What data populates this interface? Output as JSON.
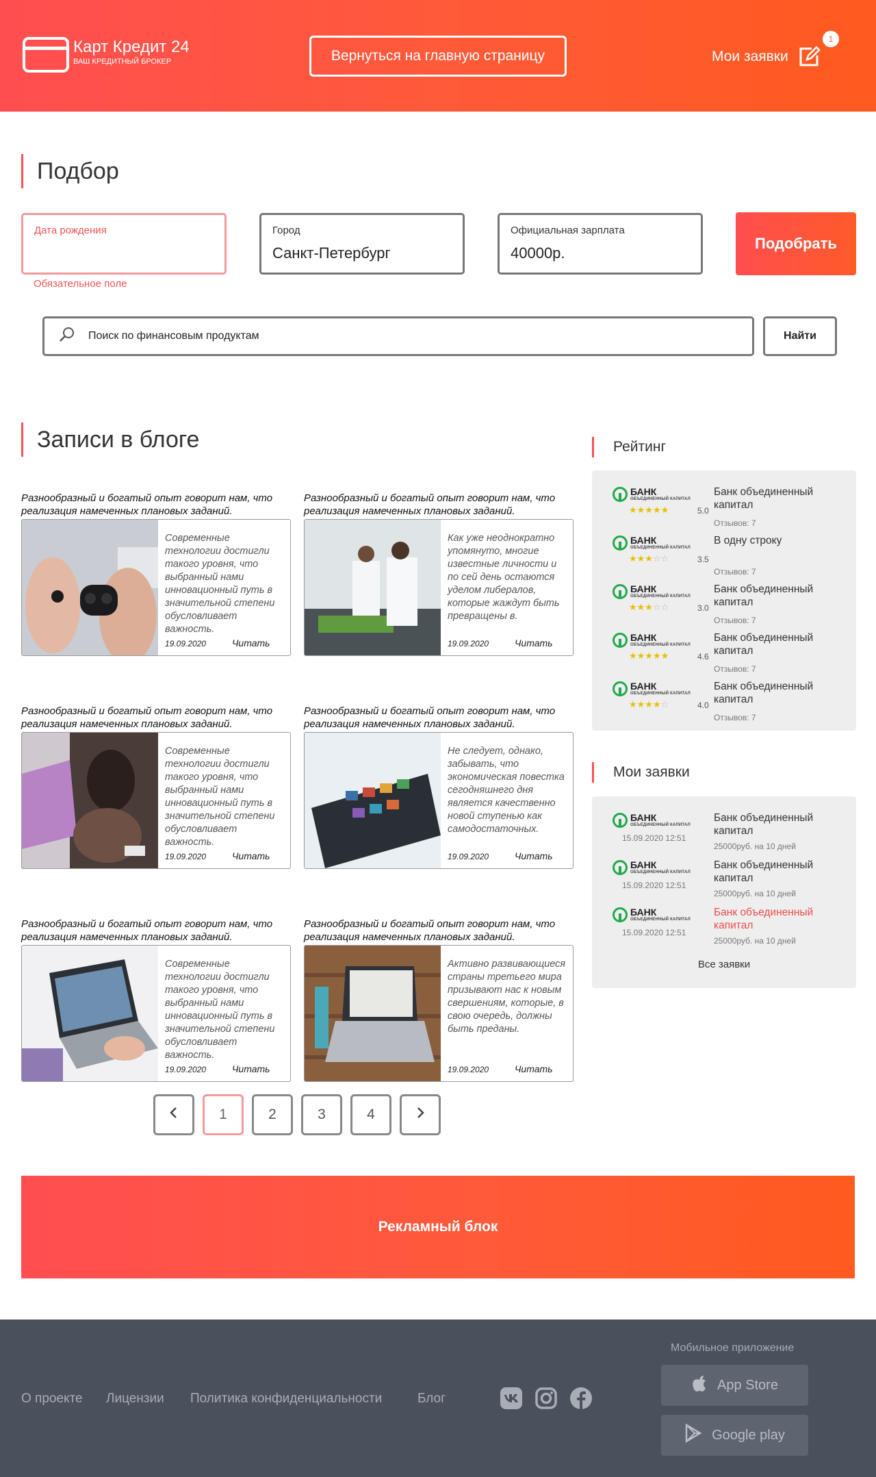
{
  "header": {
    "logo_title": "Карт Кредит 24",
    "logo_subtitle": "ВАШ КРЕДИТНЫЙ БРОКЕР",
    "back_button": "Вернуться на главную страницу",
    "my_apps": "Мои заявки",
    "badge_count": "1"
  },
  "filter": {
    "title": "Подбор",
    "birth_label": "Дата рождения",
    "birth_value": "",
    "required_msg": "Обязательное поле",
    "city_label": "Город",
    "city_value": "Санкт-Петербург",
    "salary_label": "Официальная зарплата",
    "salary_value": "40000р.",
    "submit": "Подобрать",
    "search_placeholder": "Поиск по финансовым продуктам",
    "search_button": "Найти"
  },
  "blog": {
    "title": "Записи в блоге",
    "posts": [
      {
        "title": "Разнообразный и богатый опыт говорит нам, что реализация намеченных плановых заданий.",
        "text": "Современные технологии достигли такого уровня, что выбранный нами инновационный путь в значительной степени обусловливает важность.",
        "date": "19.09.2020",
        "read": "Читать"
      },
      {
        "title": "Разнообразный и богатый опыт говорит нам, что реализация намеченных плановых заданий.",
        "text": "Как уже неоднократно упомянуто, многие известные личности и по сей день остаются уделом либералов, которые жаждут быть превращены в.",
        "date": "19.09.2020",
        "read": "Читать"
      },
      {
        "title": "Разнообразный и богатый опыт говорит нам, что реализация намеченных плановых заданий.",
        "text": "Современные технологии достигли такого уровня, что выбранный нами инновационный путь в значительной степени обусловливает важность.",
        "date": "19.09.2020",
        "read": "Читать"
      },
      {
        "title": "Разнообразный и богатый опыт говорит нам, что реализация намеченных плановых заданий.",
        "text": "Не следует, однако, забывать, что экономическая повестка сегодняшнего дня является качественно новой ступенью как самодостаточных.",
        "date": "19.09.2020",
        "read": "Читать"
      },
      {
        "title": "Разнообразный и богатый опыт говорит нам, что реализация намеченных плановых заданий.",
        "text": "Современные технологии достигли такого уровня, что выбранный нами инновационный путь в значительной степени обусловливает важность.",
        "date": "19.09.2020",
        "read": "Читать"
      },
      {
        "title": "Разнообразный и богатый опыт говорит нам, что реализация намеченных плановых заданий.",
        "text": "Активно развивающиеся страны третьего мира призывают нас к новым свершениям, которые, в свою очередь, должны быть преданы.",
        "date": "19.09.2020",
        "read": "Читать"
      }
    ],
    "pages": [
      "1",
      "2",
      "3",
      "4"
    ]
  },
  "rating": {
    "title": "Рейтинг",
    "items": [
      {
        "bank": "БАНК",
        "bank_sub": "ОБЪЕДИНЕННЫЙ КАПИТАЛ",
        "name": "Банк объединенный капитал",
        "reviews": "Отзывов: 7",
        "score": "5.0",
        "stars": 5
      },
      {
        "bank": "БАНК",
        "bank_sub": "ОБЪЕДИНЕННЫЙ КАПИТАЛ",
        "name": "В одну строку",
        "reviews": "Отзывов: 7",
        "score": "3.5",
        "stars": 3
      },
      {
        "bank": "БАНК",
        "bank_sub": "ОБЪЕДИНЕННЫЙ КАПИТАЛ",
        "name": "Банк объединенный капитал",
        "reviews": "Отзывов: 7",
        "score": "3.0",
        "stars": 3
      },
      {
        "bank": "БАНК",
        "bank_sub": "ОБЪЕДИНЕННЫЙ КАПИТАЛ",
        "name": "Банк объединенный капитал",
        "reviews": "Отзывов: 7",
        "score": "4.6",
        "stars": 5
      },
      {
        "bank": "БАНК",
        "bank_sub": "ОБЪЕДИНЕННЫЙ КАПИТАЛ",
        "name": "Банк объединенный капитал",
        "reviews": "Отзывов: 7",
        "score": "4.0",
        "stars": 4
      }
    ]
  },
  "applications": {
    "title": "Мои заявки",
    "items": [
      {
        "bank": "БАНК",
        "bank_sub": "ОБЪЕДИНЕННЫЙ КАПИТАЛ",
        "date": "15.09.2020 12:51",
        "name": "Банк объединенный капитал",
        "details": "25000руб. на 10 дней"
      },
      {
        "bank": "БАНК",
        "bank_sub": "ОБЪЕДИНЕННЫЙ КАПИТАЛ",
        "date": "15.09.2020 12:51",
        "name": "Банк объединенный капитал",
        "details": "25000руб. на 10 дней"
      },
      {
        "bank": "БАНК",
        "bank_sub": "ОБЪЕДИНЕННЫЙ КАПИТАЛ",
        "date": "15.09.2020 12:51",
        "name": "Банк объединенный капитал",
        "details": "25000руб. на 10 дней"
      }
    ],
    "all": "Все заявки"
  },
  "ad": {
    "label": "Рекламный блок"
  },
  "footer": {
    "links": [
      "О проекте",
      "Лицензии",
      "Политика конфиденциальности",
      "Блог"
    ],
    "mobile_label": "Мобильное приложение",
    "app_store": "App Store",
    "google_play": "Google play"
  },
  "colors": {
    "accent": "#ff4e50",
    "accent2": "#ff5a1f",
    "footer_bg": "#4a505c",
    "bank_green": "#22a94c",
    "star": "#e6c000"
  }
}
